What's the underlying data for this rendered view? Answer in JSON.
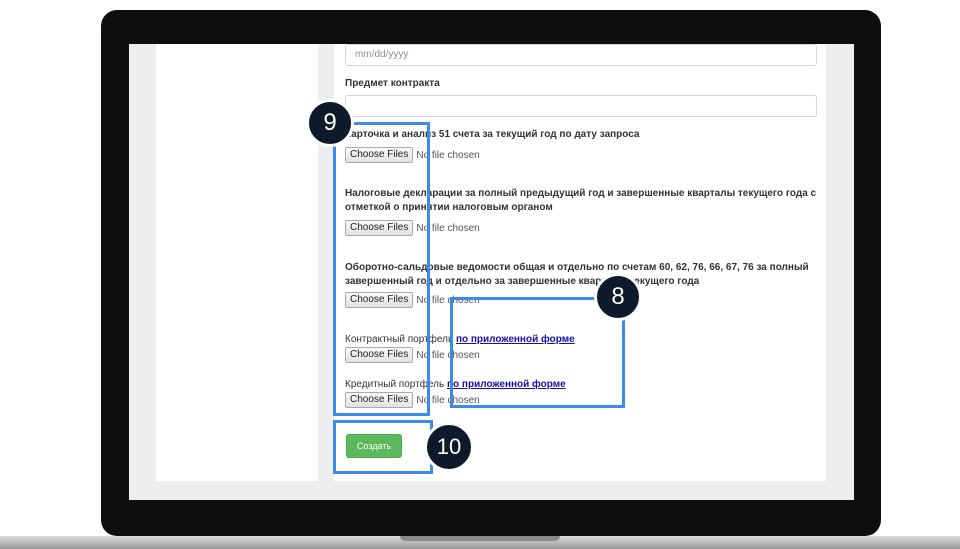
{
  "form": {
    "date_field": {
      "placeholder": "mm/dd/yyyy"
    },
    "subject": {
      "label": "Предмет контракта",
      "value": ""
    },
    "file_sections": [
      {
        "label": "Карточка и анализ 51 счета за текущий год по дату запроса"
      },
      {
        "label": "Налоговые декларации за полный предыдущий год и завершенные кварталы текущего года с отметкой о принятии налоговым органом"
      },
      {
        "label": "Оборотно-сальдовые ведомости общая и отдельно по счетам 60, 62, 76, 66, 67, 76 за полный завершенный год и отдельно за завершенные кварталы текущего года"
      },
      {
        "label": "Контрактный портфель",
        "link": "по приложенной форме"
      },
      {
        "label": "Кредитный портфель",
        "link": "по приложенной форме"
      }
    ],
    "choose_files_label": "Choose Files",
    "no_file_label": "No file chosen",
    "submit_label": "Создать"
  },
  "annotations": [
    {
      "number": "9"
    },
    {
      "number": "8"
    },
    {
      "number": "10"
    }
  ],
  "colors": {
    "highlight": "#3c8be8",
    "badge_bg": "#0e1a2c",
    "submit_bg": "#5cb85c",
    "link": "#1a0dab"
  }
}
